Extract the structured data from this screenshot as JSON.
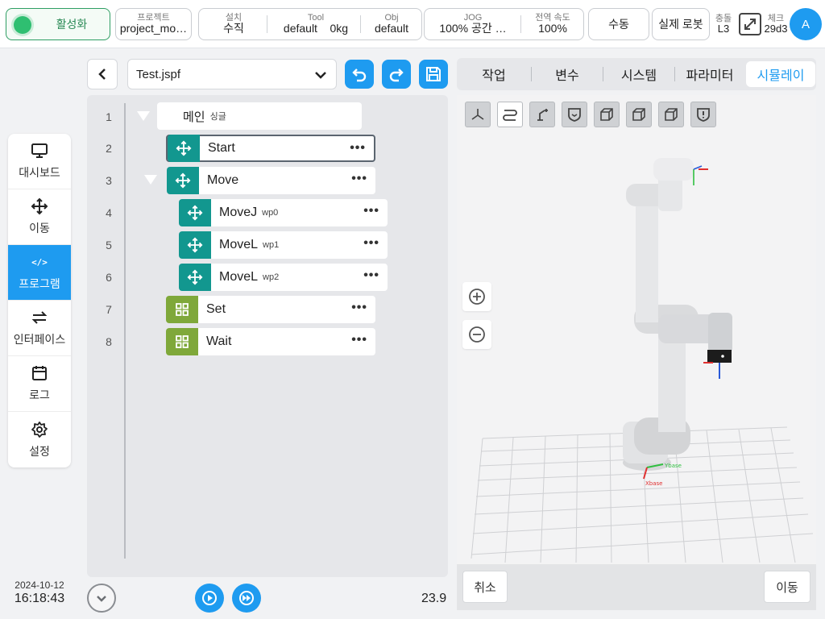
{
  "topbar": {
    "activate_label": "활성화",
    "project_label": "프로젝트",
    "project_value": "project_mo…",
    "install_label": "설치",
    "install_value": "수직",
    "tool_label": "Tool",
    "tool_value": "default",
    "tool_weight": "0kg",
    "obj_label": "Obj",
    "obj_value": "default",
    "jog_label": "JOG",
    "jog_value": "100%  공간 …",
    "global_speed_label": "전역 속도",
    "global_speed_value": "100%",
    "manual_label": "수동",
    "real_robot_label": "실제 로봇",
    "collision_label": "충돌",
    "collision_value": "L3",
    "check_label": "체크",
    "check_value": "29d3",
    "avatar_letter": "A",
    "accent_color": "#1e9bf0",
    "active_color": "#2fbf71"
  },
  "sidebar": {
    "items": [
      {
        "label": "대시보드",
        "icon": "monitor-icon"
      },
      {
        "label": "이동",
        "icon": "move-arrows-icon"
      },
      {
        "label": "프로그램",
        "icon": "code-icon",
        "code": "</>"
      },
      {
        "label": "인터페이스",
        "icon": "swap-arrows-icon"
      },
      {
        "label": "로그",
        "icon": "calendar-icon"
      },
      {
        "label": "설정",
        "icon": "gear-icon"
      }
    ],
    "date": "2024-10-12",
    "time": "16:18:43"
  },
  "program": {
    "file_name": "Test.jspf",
    "line_numbers": [
      "1",
      "2",
      "3",
      "4",
      "5",
      "6",
      "7",
      "8"
    ],
    "nodes": [
      {
        "label": "메인",
        "sub": "싱글"
      },
      {
        "label": "Start",
        "sub": ""
      },
      {
        "label": "Move",
        "sub": ""
      },
      {
        "label": "MoveJ",
        "sub": "wp0"
      },
      {
        "label": "MoveL",
        "sub": "wp1"
      },
      {
        "label": "MoveL",
        "sub": "wp2"
      },
      {
        "label": "Set",
        "sub": ""
      },
      {
        "label": "Wait",
        "sub": ""
      }
    ],
    "more_glyph": "•••",
    "speed_value": "23.9",
    "teal_color": "#12978f",
    "green_color": "#7fa83a"
  },
  "right": {
    "tabs": [
      "작업",
      "변수",
      "시스템",
      "파라미터",
      "시뮬레이"
    ],
    "active_tab": "시뮬레이",
    "cancel_label": "취소",
    "move_label": "이동",
    "axis_x_label": "Xbase",
    "axis_y_label": "Ybase"
  }
}
